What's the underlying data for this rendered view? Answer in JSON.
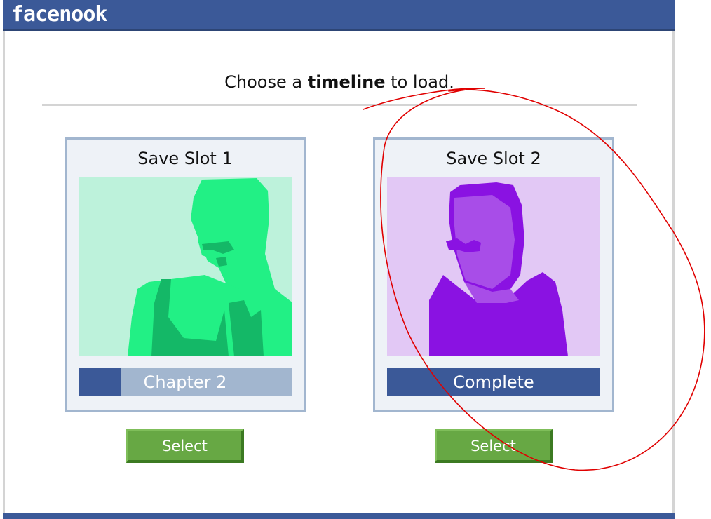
{
  "app": {
    "logo": "facenook",
    "brand_color": "#3b5998"
  },
  "heading": {
    "prefix": "Choose a ",
    "emphasis": "timeline",
    "suffix": " to load."
  },
  "slots": [
    {
      "title": "Save Slot 1",
      "status": "Chapter 2",
      "progress": 0.2,
      "portrait_theme": "green",
      "select_label": "Select"
    },
    {
      "title": "Save Slot 2",
      "status": "Complete",
      "progress": 1.0,
      "portrait_theme": "purple",
      "select_label": "Select"
    }
  ],
  "colors": {
    "green_bg": "#bdf2db",
    "green_mid": "#22f085",
    "green_dark": "#14b867",
    "purple_bg": "#e2c8f5",
    "purple_mid": "#a84de8",
    "purple_dark": "#8a12e2",
    "button_green": "#67a844",
    "annotation": "#e00000"
  }
}
